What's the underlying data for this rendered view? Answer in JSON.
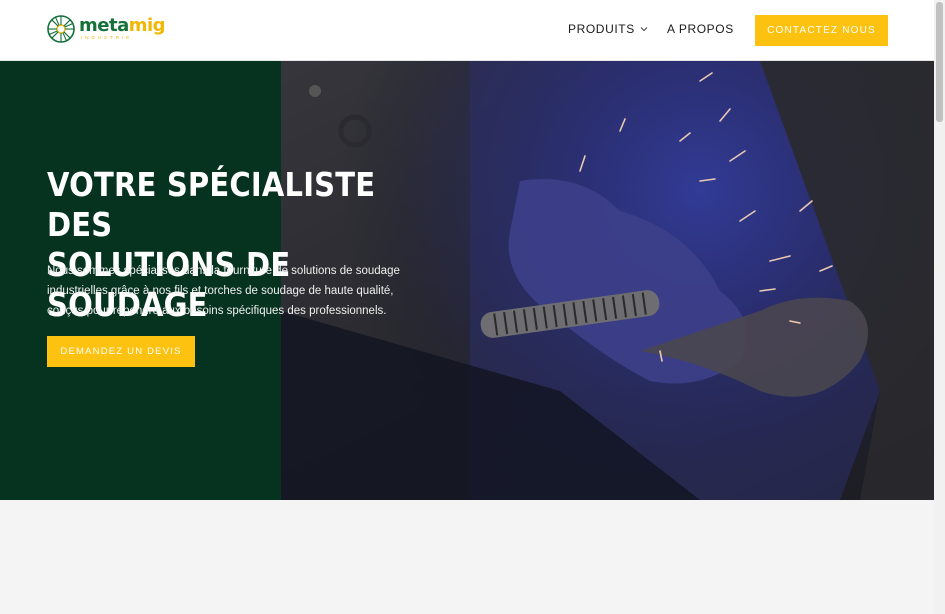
{
  "header": {
    "logo": {
      "word_meta": "meta",
      "word_mig": "mig",
      "tagline": "INDUSTRIE"
    },
    "nav": {
      "produits": "PRODUITS",
      "apropos": "A PROPOS"
    },
    "cta": "CONTACTEZ NOUS"
  },
  "hero": {
    "title_line1": "VOTRE SPÉCIALISTE DES",
    "title_line2": "SOLUTIONS DE SOUDAGE",
    "text_line1": "Nous sommes spécialisés dans la fourniture de solutions de soudage",
    "text_line2": "industrielles grâce à nos fils et torches de soudage de haute qualité,",
    "text_line3": "conçus pour répondre aux besoins spécifiques des professionnels.",
    "cta": "DEMANDEZ UN DEVIS",
    "image": "welding-photo"
  },
  "icons": {
    "logo": "gear-logo-icon",
    "dropdown": "chevron-down-icon"
  },
  "colors": {
    "brand_green": "#063220",
    "accent_yellow": "#fdc10f",
    "logo_green": "#15703a",
    "logo_yellow": "#f2b705"
  }
}
